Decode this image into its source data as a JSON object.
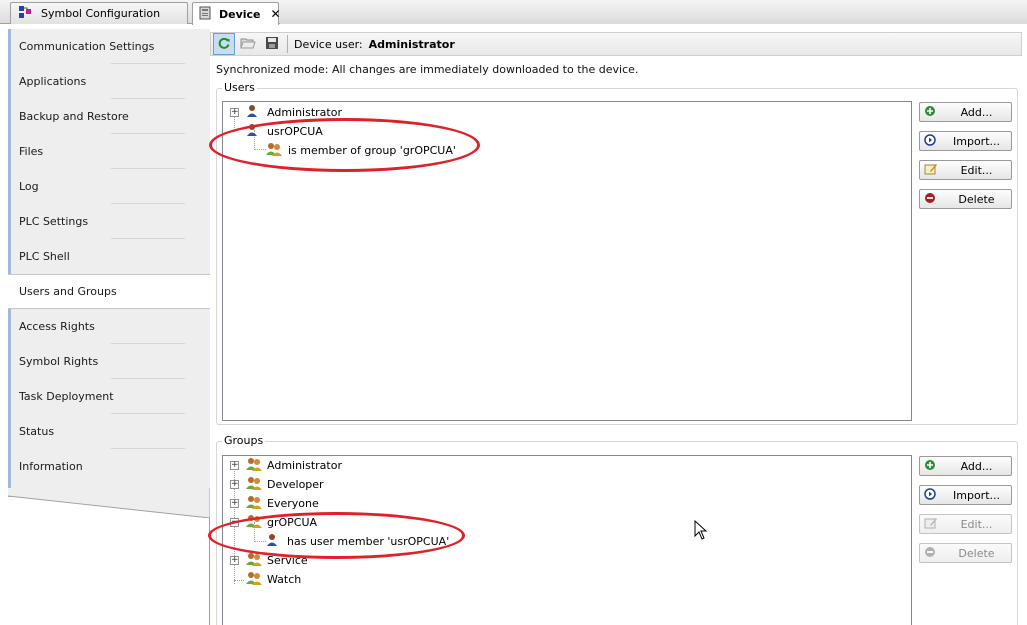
{
  "tabs": [
    {
      "label": "Symbol Configuration",
      "icon": "symbol-config-icon"
    },
    {
      "label": "Device",
      "icon": "device-icon",
      "close": "✕"
    }
  ],
  "nav": {
    "items": [
      {
        "label": "Communication Settings"
      },
      {
        "label": "Applications"
      },
      {
        "label": "Backup and Restore"
      },
      {
        "label": "Files"
      },
      {
        "label": "Log"
      },
      {
        "label": "PLC Settings"
      },
      {
        "label": "PLC Shell"
      },
      {
        "label": "Users and Groups",
        "selected": true
      },
      {
        "label": "Access Rights"
      },
      {
        "label": "Symbol Rights"
      },
      {
        "label": "Task Deployment"
      },
      {
        "label": "Status"
      },
      {
        "label": "Information"
      }
    ]
  },
  "toolbar": {
    "device_user_label": "Device user:",
    "device_user_value": "Administrator"
  },
  "sync_text": "Synchronized mode: All changes are immediately downloaded to the device.",
  "users": {
    "title": "Users",
    "items": [
      {
        "label": "Administrator"
      },
      {
        "label": "usrOPCUA"
      },
      {
        "label": "is member of group 'grOPCUA'"
      }
    ],
    "buttons": {
      "add": "Add...",
      "import": "Import...",
      "edit": "Edit...",
      "delete": "Delete"
    }
  },
  "groups": {
    "title": "Groups",
    "items": [
      {
        "label": "Administrator"
      },
      {
        "label": "Developer"
      },
      {
        "label": "Everyone"
      },
      {
        "label": "grOPCUA"
      },
      {
        "label": "has user member 'usrOPCUA'"
      },
      {
        "label": "Service"
      },
      {
        "label": "Watch"
      }
    ],
    "buttons": {
      "add": "Add...",
      "import": "Import...",
      "edit": "Edit...",
      "delete": "Delete"
    }
  },
  "colors": {
    "highlight_ellipse": "#e0202a",
    "selected_toolbar": "#c9dcf2"
  }
}
